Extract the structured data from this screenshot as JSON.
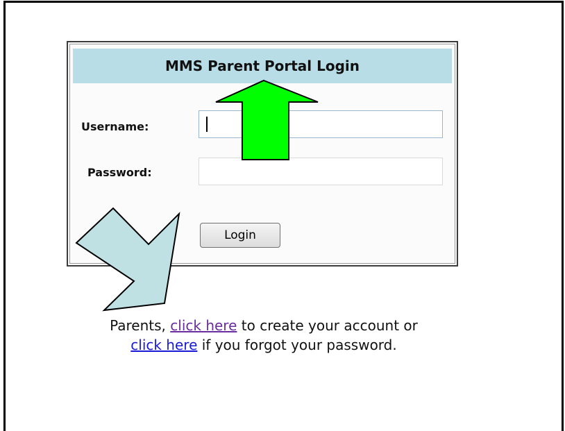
{
  "login": {
    "title": "MMS Parent Portal Login",
    "username_label": "Username:",
    "username_value": "",
    "password_label": "Password:",
    "password_value": "",
    "login_button": "Login"
  },
  "note": {
    "prefix": "Parents,",
    "link_create": "click here",
    "middle": "to create your account or",
    "link_forgot": "click here",
    "suffix": "if you forgot your password."
  },
  "colors": {
    "header_bg": "#b8dde6",
    "up_arrow": "#00ff00",
    "down_arrow": "#bfe1e4",
    "visited_link": "#6a2c9e",
    "link": "#1a1ad6"
  }
}
